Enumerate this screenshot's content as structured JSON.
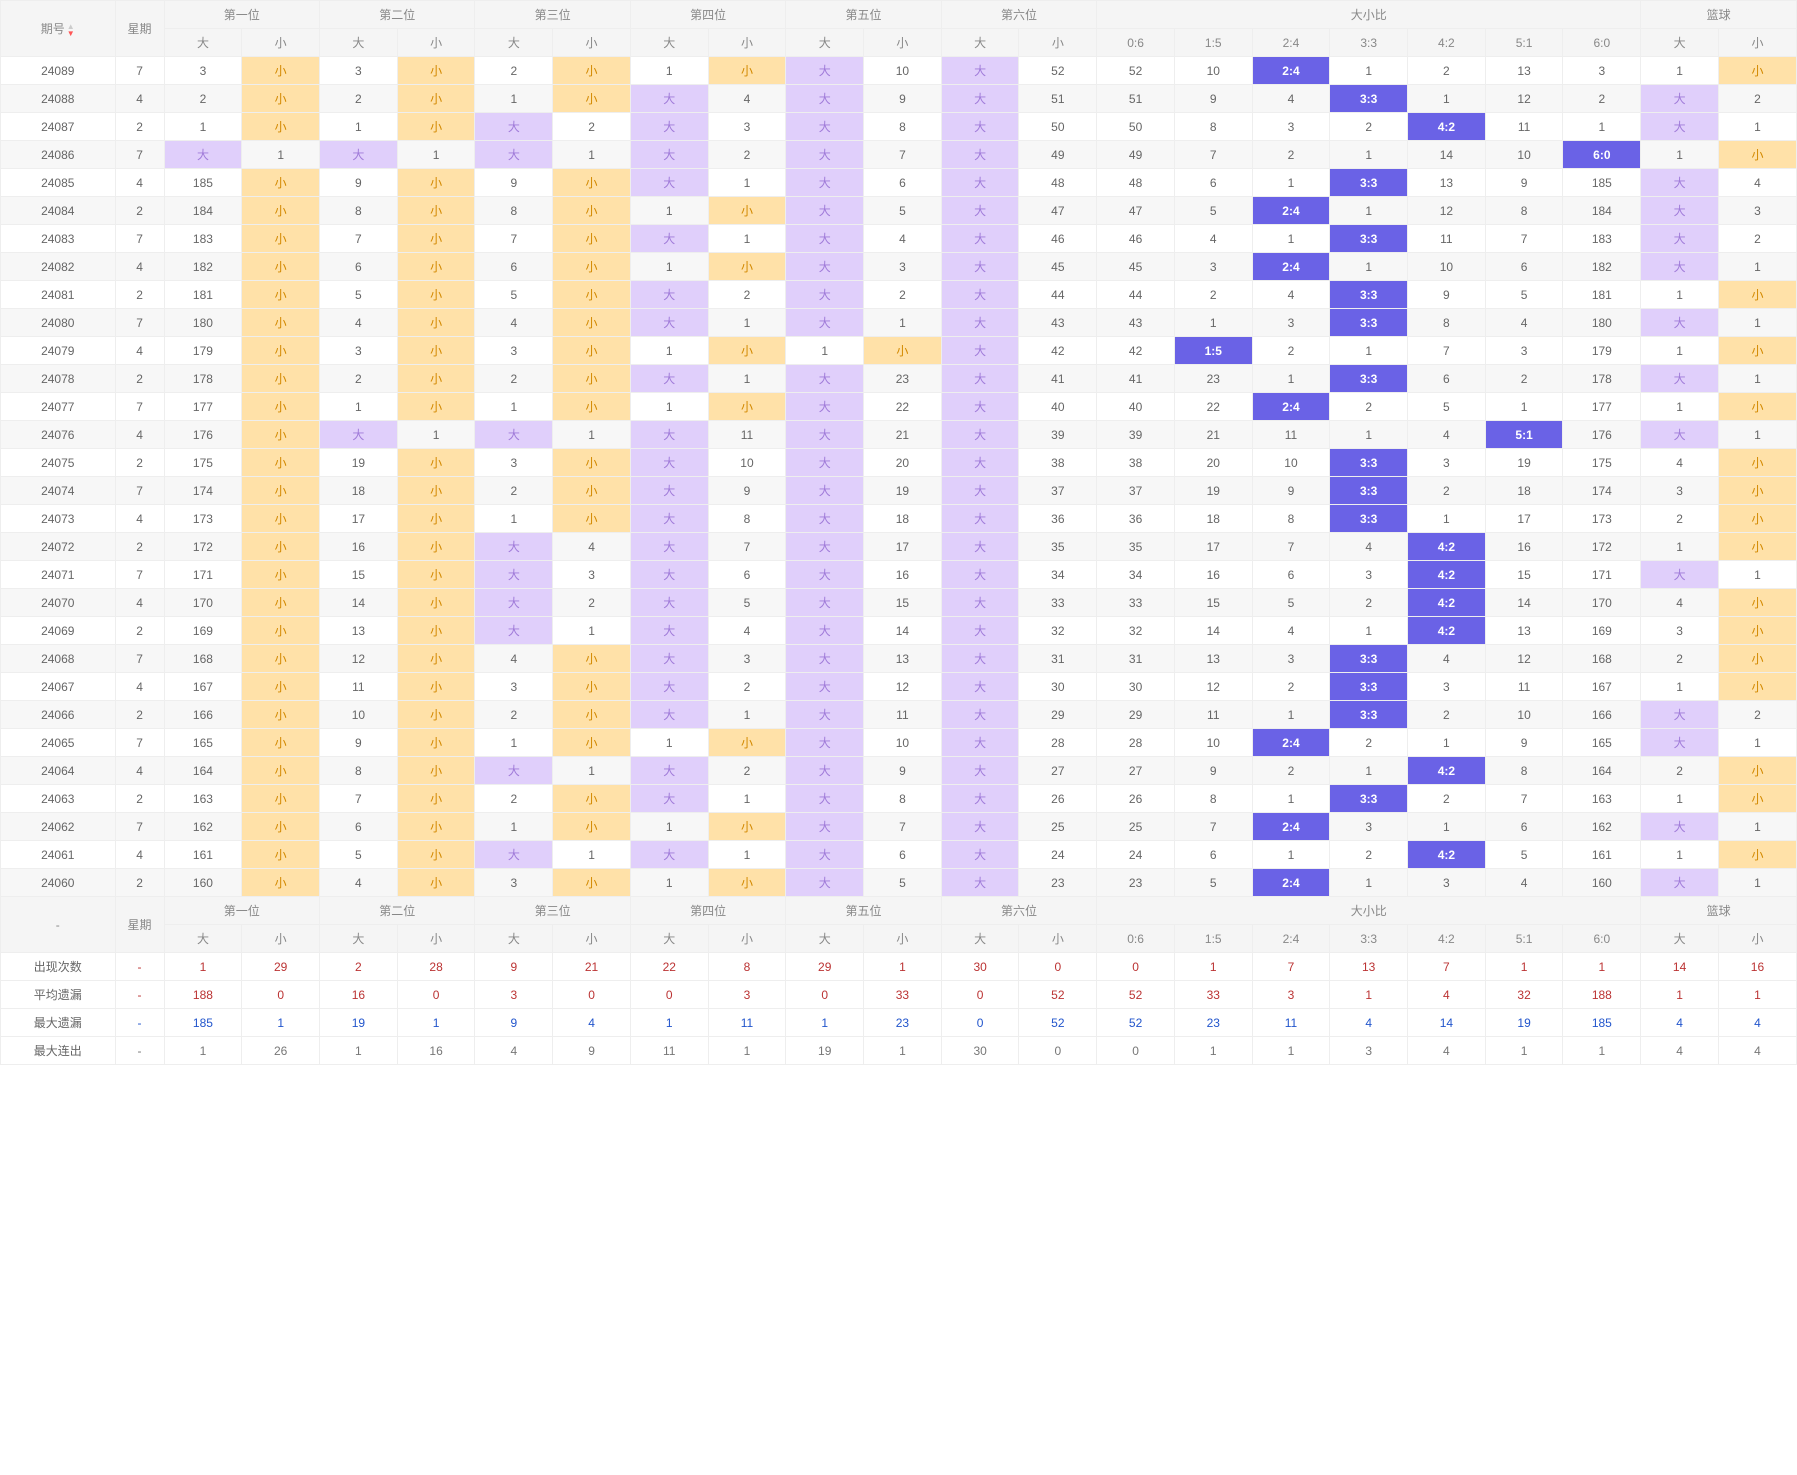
{
  "headers": {
    "issue": "期号",
    "week": "星期",
    "pos": [
      "第一位",
      "第二位",
      "第三位",
      "第四位",
      "第五位",
      "第六位"
    ],
    "ratio": "大小比",
    "blue": "篮球",
    "big": "大",
    "small": "小",
    "ratios": [
      "0:6",
      "1:5",
      "2:4",
      "3:3",
      "4:2",
      "5:1",
      "6:0"
    ]
  },
  "stats_labels": {
    "dash": "-",
    "appear": "出现次数",
    "avgmiss": "平均遗漏",
    "maxmiss": "最大遗漏",
    "maxrun": "最大连出"
  },
  "rows": [
    {
      "issue": "24089",
      "wk": "7",
      "p1": [
        "3",
        "小"
      ],
      "p2": [
        "3",
        "小"
      ],
      "p3": [
        "2",
        "小"
      ],
      "p4": [
        "1",
        "小"
      ],
      "p5": [
        "大",
        "10"
      ],
      "p6": [
        "大",
        "52"
      ],
      "r": [
        "52",
        "10",
        "2:4",
        "1",
        "2",
        "13",
        "3"
      ],
      "rhit": 2,
      "blue": [
        "1",
        "小"
      ]
    },
    {
      "issue": "24088",
      "wk": "4",
      "p1": [
        "2",
        "小"
      ],
      "p2": [
        "2",
        "小"
      ],
      "p3": [
        "1",
        "小"
      ],
      "p4": [
        "大",
        "4"
      ],
      "p5": [
        "大",
        "9"
      ],
      "p6": [
        "大",
        "51"
      ],
      "r": [
        "51",
        "9",
        "4",
        "3:3",
        "1",
        "12",
        "2"
      ],
      "rhit": 3,
      "blue": [
        "大",
        "2"
      ]
    },
    {
      "issue": "24087",
      "wk": "2",
      "p1": [
        "1",
        "小"
      ],
      "p2": [
        "1",
        "小"
      ],
      "p3": [
        "大",
        "2"
      ],
      "p4": [
        "大",
        "3"
      ],
      "p5": [
        "大",
        "8"
      ],
      "p6": [
        "大",
        "50"
      ],
      "r": [
        "50",
        "8",
        "3",
        "2",
        "4:2",
        "11",
        "1"
      ],
      "rhit": 4,
      "blue": [
        "大",
        "1"
      ]
    },
    {
      "issue": "24086",
      "wk": "7",
      "p1": [
        "大",
        "1"
      ],
      "p2": [
        "大",
        "1"
      ],
      "p3": [
        "大",
        "1"
      ],
      "p4": [
        "大",
        "2"
      ],
      "p5": [
        "大",
        "7"
      ],
      "p6": [
        "大",
        "49"
      ],
      "r": [
        "49",
        "7",
        "2",
        "1",
        "14",
        "10",
        "6:0"
      ],
      "rhit": 6,
      "blue": [
        "1",
        "小"
      ]
    },
    {
      "issue": "24085",
      "wk": "4",
      "p1": [
        "185",
        "小"
      ],
      "p2": [
        "9",
        "小"
      ],
      "p3": [
        "9",
        "小"
      ],
      "p4": [
        "大",
        "1"
      ],
      "p5": [
        "大",
        "6"
      ],
      "p6": [
        "大",
        "48"
      ],
      "r": [
        "48",
        "6",
        "1",
        "3:3",
        "13",
        "9",
        "185"
      ],
      "rhit": 3,
      "blue": [
        "大",
        "4"
      ]
    },
    {
      "issue": "24084",
      "wk": "2",
      "p1": [
        "184",
        "小"
      ],
      "p2": [
        "8",
        "小"
      ],
      "p3": [
        "8",
        "小"
      ],
      "p4": [
        "1",
        "小"
      ],
      "p5": [
        "大",
        "5"
      ],
      "p6": [
        "大",
        "47"
      ],
      "r": [
        "47",
        "5",
        "2:4",
        "1",
        "12",
        "8",
        "184"
      ],
      "rhit": 2,
      "blue": [
        "大",
        "3"
      ]
    },
    {
      "issue": "24083",
      "wk": "7",
      "p1": [
        "183",
        "小"
      ],
      "p2": [
        "7",
        "小"
      ],
      "p3": [
        "7",
        "小"
      ],
      "p4": [
        "大",
        "1"
      ],
      "p5": [
        "大",
        "4"
      ],
      "p6": [
        "大",
        "46"
      ],
      "r": [
        "46",
        "4",
        "1",
        "3:3",
        "11",
        "7",
        "183"
      ],
      "rhit": 3,
      "blue": [
        "大",
        "2"
      ]
    },
    {
      "issue": "24082",
      "wk": "4",
      "p1": [
        "182",
        "小"
      ],
      "p2": [
        "6",
        "小"
      ],
      "p3": [
        "6",
        "小"
      ],
      "p4": [
        "1",
        "小"
      ],
      "p5": [
        "大",
        "3"
      ],
      "p6": [
        "大",
        "45"
      ],
      "r": [
        "45",
        "3",
        "2:4",
        "1",
        "10",
        "6",
        "182"
      ],
      "rhit": 2,
      "blue": [
        "大",
        "1"
      ]
    },
    {
      "issue": "24081",
      "wk": "2",
      "p1": [
        "181",
        "小"
      ],
      "p2": [
        "5",
        "小"
      ],
      "p3": [
        "5",
        "小"
      ],
      "p4": [
        "大",
        "2"
      ],
      "p5": [
        "大",
        "2"
      ],
      "p6": [
        "大",
        "44"
      ],
      "r": [
        "44",
        "2",
        "4",
        "3:3",
        "9",
        "5",
        "181"
      ],
      "rhit": 3,
      "blue": [
        "1",
        "小"
      ]
    },
    {
      "issue": "24080",
      "wk": "7",
      "p1": [
        "180",
        "小"
      ],
      "p2": [
        "4",
        "小"
      ],
      "p3": [
        "4",
        "小"
      ],
      "p4": [
        "大",
        "1"
      ],
      "p5": [
        "大",
        "1"
      ],
      "p6": [
        "大",
        "43"
      ],
      "r": [
        "43",
        "1",
        "3",
        "3:3",
        "8",
        "4",
        "180"
      ],
      "rhit": 3,
      "blue": [
        "大",
        "1"
      ]
    },
    {
      "issue": "24079",
      "wk": "4",
      "p1": [
        "179",
        "小"
      ],
      "p2": [
        "3",
        "小"
      ],
      "p3": [
        "3",
        "小"
      ],
      "p4": [
        "1",
        "小"
      ],
      "p5": [
        "1",
        "小"
      ],
      "p6": [
        "大",
        "42"
      ],
      "r": [
        "42",
        "1:5",
        "2",
        "1",
        "7",
        "3",
        "179"
      ],
      "rhit": 1,
      "blue": [
        "1",
        "小"
      ]
    },
    {
      "issue": "24078",
      "wk": "2",
      "p1": [
        "178",
        "小"
      ],
      "p2": [
        "2",
        "小"
      ],
      "p3": [
        "2",
        "小"
      ],
      "p4": [
        "大",
        "1"
      ],
      "p5": [
        "大",
        "23"
      ],
      "p6": [
        "大",
        "41"
      ],
      "r": [
        "41",
        "23",
        "1",
        "3:3",
        "6",
        "2",
        "178"
      ],
      "rhit": 3,
      "blue": [
        "大",
        "1"
      ]
    },
    {
      "issue": "24077",
      "wk": "7",
      "p1": [
        "177",
        "小"
      ],
      "p2": [
        "1",
        "小"
      ],
      "p3": [
        "1",
        "小"
      ],
      "p4": [
        "1",
        "小"
      ],
      "p5": [
        "大",
        "22"
      ],
      "p6": [
        "大",
        "40"
      ],
      "r": [
        "40",
        "22",
        "2:4",
        "2",
        "5",
        "1",
        "177"
      ],
      "rhit": 2,
      "blue": [
        "1",
        "小"
      ]
    },
    {
      "issue": "24076",
      "wk": "4",
      "p1": [
        "176",
        "小"
      ],
      "p2": [
        "大",
        "1"
      ],
      "p3": [
        "大",
        "1"
      ],
      "p4": [
        "大",
        "11"
      ],
      "p5": [
        "大",
        "21"
      ],
      "p6": [
        "大",
        "39"
      ],
      "r": [
        "39",
        "21",
        "11",
        "1",
        "4",
        "5:1",
        "176"
      ],
      "rhit": 5,
      "blue": [
        "大",
        "1"
      ]
    },
    {
      "issue": "24075",
      "wk": "2",
      "p1": [
        "175",
        "小"
      ],
      "p2": [
        "19",
        "小"
      ],
      "p3": [
        "3",
        "小"
      ],
      "p4": [
        "大",
        "10"
      ],
      "p5": [
        "大",
        "20"
      ],
      "p6": [
        "大",
        "38"
      ],
      "r": [
        "38",
        "20",
        "10",
        "3:3",
        "3",
        "19",
        "175"
      ],
      "rhit": 3,
      "blue": [
        "4",
        "小"
      ]
    },
    {
      "issue": "24074",
      "wk": "7",
      "p1": [
        "174",
        "小"
      ],
      "p2": [
        "18",
        "小"
      ],
      "p3": [
        "2",
        "小"
      ],
      "p4": [
        "大",
        "9"
      ],
      "p5": [
        "大",
        "19"
      ],
      "p6": [
        "大",
        "37"
      ],
      "r": [
        "37",
        "19",
        "9",
        "3:3",
        "2",
        "18",
        "174"
      ],
      "rhit": 3,
      "blue": [
        "3",
        "小"
      ]
    },
    {
      "issue": "24073",
      "wk": "4",
      "p1": [
        "173",
        "小"
      ],
      "p2": [
        "17",
        "小"
      ],
      "p3": [
        "1",
        "小"
      ],
      "p4": [
        "大",
        "8"
      ],
      "p5": [
        "大",
        "18"
      ],
      "p6": [
        "大",
        "36"
      ],
      "r": [
        "36",
        "18",
        "8",
        "3:3",
        "1",
        "17",
        "173"
      ],
      "rhit": 3,
      "blue": [
        "2",
        "小"
      ]
    },
    {
      "issue": "24072",
      "wk": "2",
      "p1": [
        "172",
        "小"
      ],
      "p2": [
        "16",
        "小"
      ],
      "p3": [
        "大",
        "4"
      ],
      "p4": [
        "大",
        "7"
      ],
      "p5": [
        "大",
        "17"
      ],
      "p6": [
        "大",
        "35"
      ],
      "r": [
        "35",
        "17",
        "7",
        "4",
        "4:2",
        "16",
        "172"
      ],
      "rhit": 4,
      "blue": [
        "1",
        "小"
      ]
    },
    {
      "issue": "24071",
      "wk": "7",
      "p1": [
        "171",
        "小"
      ],
      "p2": [
        "15",
        "小"
      ],
      "p3": [
        "大",
        "3"
      ],
      "p4": [
        "大",
        "6"
      ],
      "p5": [
        "大",
        "16"
      ],
      "p6": [
        "大",
        "34"
      ],
      "r": [
        "34",
        "16",
        "6",
        "3",
        "4:2",
        "15",
        "171"
      ],
      "rhit": 4,
      "blue": [
        "大",
        "1"
      ]
    },
    {
      "issue": "24070",
      "wk": "4",
      "p1": [
        "170",
        "小"
      ],
      "p2": [
        "14",
        "小"
      ],
      "p3": [
        "大",
        "2"
      ],
      "p4": [
        "大",
        "5"
      ],
      "p5": [
        "大",
        "15"
      ],
      "p6": [
        "大",
        "33"
      ],
      "r": [
        "33",
        "15",
        "5",
        "2",
        "4:2",
        "14",
        "170"
      ],
      "rhit": 4,
      "blue": [
        "4",
        "小"
      ]
    },
    {
      "issue": "24069",
      "wk": "2",
      "p1": [
        "169",
        "小"
      ],
      "p2": [
        "13",
        "小"
      ],
      "p3": [
        "大",
        "1"
      ],
      "p4": [
        "大",
        "4"
      ],
      "p5": [
        "大",
        "14"
      ],
      "p6": [
        "大",
        "32"
      ],
      "r": [
        "32",
        "14",
        "4",
        "1",
        "4:2",
        "13",
        "169"
      ],
      "rhit": 4,
      "blue": [
        "3",
        "小"
      ]
    },
    {
      "issue": "24068",
      "wk": "7",
      "p1": [
        "168",
        "小"
      ],
      "p2": [
        "12",
        "小"
      ],
      "p3": [
        "4",
        "小"
      ],
      "p4": [
        "大",
        "3"
      ],
      "p5": [
        "大",
        "13"
      ],
      "p6": [
        "大",
        "31"
      ],
      "r": [
        "31",
        "13",
        "3",
        "3:3",
        "4",
        "12",
        "168"
      ],
      "rhit": 3,
      "blue": [
        "2",
        "小"
      ]
    },
    {
      "issue": "24067",
      "wk": "4",
      "p1": [
        "167",
        "小"
      ],
      "p2": [
        "11",
        "小"
      ],
      "p3": [
        "3",
        "小"
      ],
      "p4": [
        "大",
        "2"
      ],
      "p5": [
        "大",
        "12"
      ],
      "p6": [
        "大",
        "30"
      ],
      "r": [
        "30",
        "12",
        "2",
        "3:3",
        "3",
        "11",
        "167"
      ],
      "rhit": 3,
      "blue": [
        "1",
        "小"
      ]
    },
    {
      "issue": "24066",
      "wk": "2",
      "p1": [
        "166",
        "小"
      ],
      "p2": [
        "10",
        "小"
      ],
      "p3": [
        "2",
        "小"
      ],
      "p4": [
        "大",
        "1"
      ],
      "p5": [
        "大",
        "11"
      ],
      "p6": [
        "大",
        "29"
      ],
      "r": [
        "29",
        "11",
        "1",
        "3:3",
        "2",
        "10",
        "166"
      ],
      "rhit": 3,
      "blue": [
        "大",
        "2"
      ]
    },
    {
      "issue": "24065",
      "wk": "7",
      "p1": [
        "165",
        "小"
      ],
      "p2": [
        "9",
        "小"
      ],
      "p3": [
        "1",
        "小"
      ],
      "p4": [
        "1",
        "小"
      ],
      "p5": [
        "大",
        "10"
      ],
      "p6": [
        "大",
        "28"
      ],
      "r": [
        "28",
        "10",
        "2:4",
        "2",
        "1",
        "9",
        "165"
      ],
      "rhit": 2,
      "blue": [
        "大",
        "1"
      ]
    },
    {
      "issue": "24064",
      "wk": "4",
      "p1": [
        "164",
        "小"
      ],
      "p2": [
        "8",
        "小"
      ],
      "p3": [
        "大",
        "1"
      ],
      "p4": [
        "大",
        "2"
      ],
      "p5": [
        "大",
        "9"
      ],
      "p6": [
        "大",
        "27"
      ],
      "r": [
        "27",
        "9",
        "2",
        "1",
        "4:2",
        "8",
        "164"
      ],
      "rhit": 4,
      "blue": [
        "2",
        "小"
      ]
    },
    {
      "issue": "24063",
      "wk": "2",
      "p1": [
        "163",
        "小"
      ],
      "p2": [
        "7",
        "小"
      ],
      "p3": [
        "2",
        "小"
      ],
      "p4": [
        "大",
        "1"
      ],
      "p5": [
        "大",
        "8"
      ],
      "p6": [
        "大",
        "26"
      ],
      "r": [
        "26",
        "8",
        "1",
        "3:3",
        "2",
        "7",
        "163"
      ],
      "rhit": 3,
      "blue": [
        "1",
        "小"
      ]
    },
    {
      "issue": "24062",
      "wk": "7",
      "p1": [
        "162",
        "小"
      ],
      "p2": [
        "6",
        "小"
      ],
      "p3": [
        "1",
        "小"
      ],
      "p4": [
        "1",
        "小"
      ],
      "p5": [
        "大",
        "7"
      ],
      "p6": [
        "大",
        "25"
      ],
      "r": [
        "25",
        "7",
        "2:4",
        "3",
        "1",
        "6",
        "162"
      ],
      "rhit": 2,
      "blue": [
        "大",
        "1"
      ]
    },
    {
      "issue": "24061",
      "wk": "4",
      "p1": [
        "161",
        "小"
      ],
      "p2": [
        "5",
        "小"
      ],
      "p3": [
        "大",
        "1"
      ],
      "p4": [
        "大",
        "1"
      ],
      "p5": [
        "大",
        "6"
      ],
      "p6": [
        "大",
        "24"
      ],
      "r": [
        "24",
        "6",
        "1",
        "2",
        "4:2",
        "5",
        "161"
      ],
      "rhit": 4,
      "blue": [
        "1",
        "小"
      ]
    },
    {
      "issue": "24060",
      "wk": "2",
      "p1": [
        "160",
        "小"
      ],
      "p2": [
        "4",
        "小"
      ],
      "p3": [
        "3",
        "小"
      ],
      "p4": [
        "1",
        "小"
      ],
      "p5": [
        "大",
        "5"
      ],
      "p6": [
        "大",
        "23"
      ],
      "r": [
        "23",
        "5",
        "2:4",
        "1",
        "3",
        "4",
        "160"
      ],
      "rhit": 2,
      "blue": [
        "大",
        "1"
      ]
    }
  ],
  "stats": {
    "appear": [
      "-",
      "1",
      "29",
      "2",
      "28",
      "9",
      "21",
      "22",
      "8",
      "29",
      "1",
      "30",
      "0",
      "0",
      "1",
      "7",
      "13",
      "7",
      "1",
      "1",
      "14",
      "16"
    ],
    "avgmiss": [
      "-",
      "188",
      "0",
      "16",
      "0",
      "3",
      "0",
      "0",
      "3",
      "0",
      "33",
      "0",
      "52",
      "52",
      "33",
      "3",
      "1",
      "4",
      "32",
      "188",
      "1",
      "1"
    ],
    "maxmiss": [
      "-",
      "185",
      "1",
      "19",
      "1",
      "9",
      "4",
      "1",
      "11",
      "1",
      "23",
      "0",
      "52",
      "52",
      "23",
      "11",
      "4",
      "14",
      "19",
      "185",
      "4",
      "4"
    ],
    "maxrun": [
      "-",
      "1",
      "26",
      "1",
      "16",
      "4",
      "9",
      "11",
      "1",
      "19",
      "1",
      "30",
      "0",
      "0",
      "1",
      "1",
      "3",
      "4",
      "1",
      "1",
      "4",
      "4"
    ]
  }
}
